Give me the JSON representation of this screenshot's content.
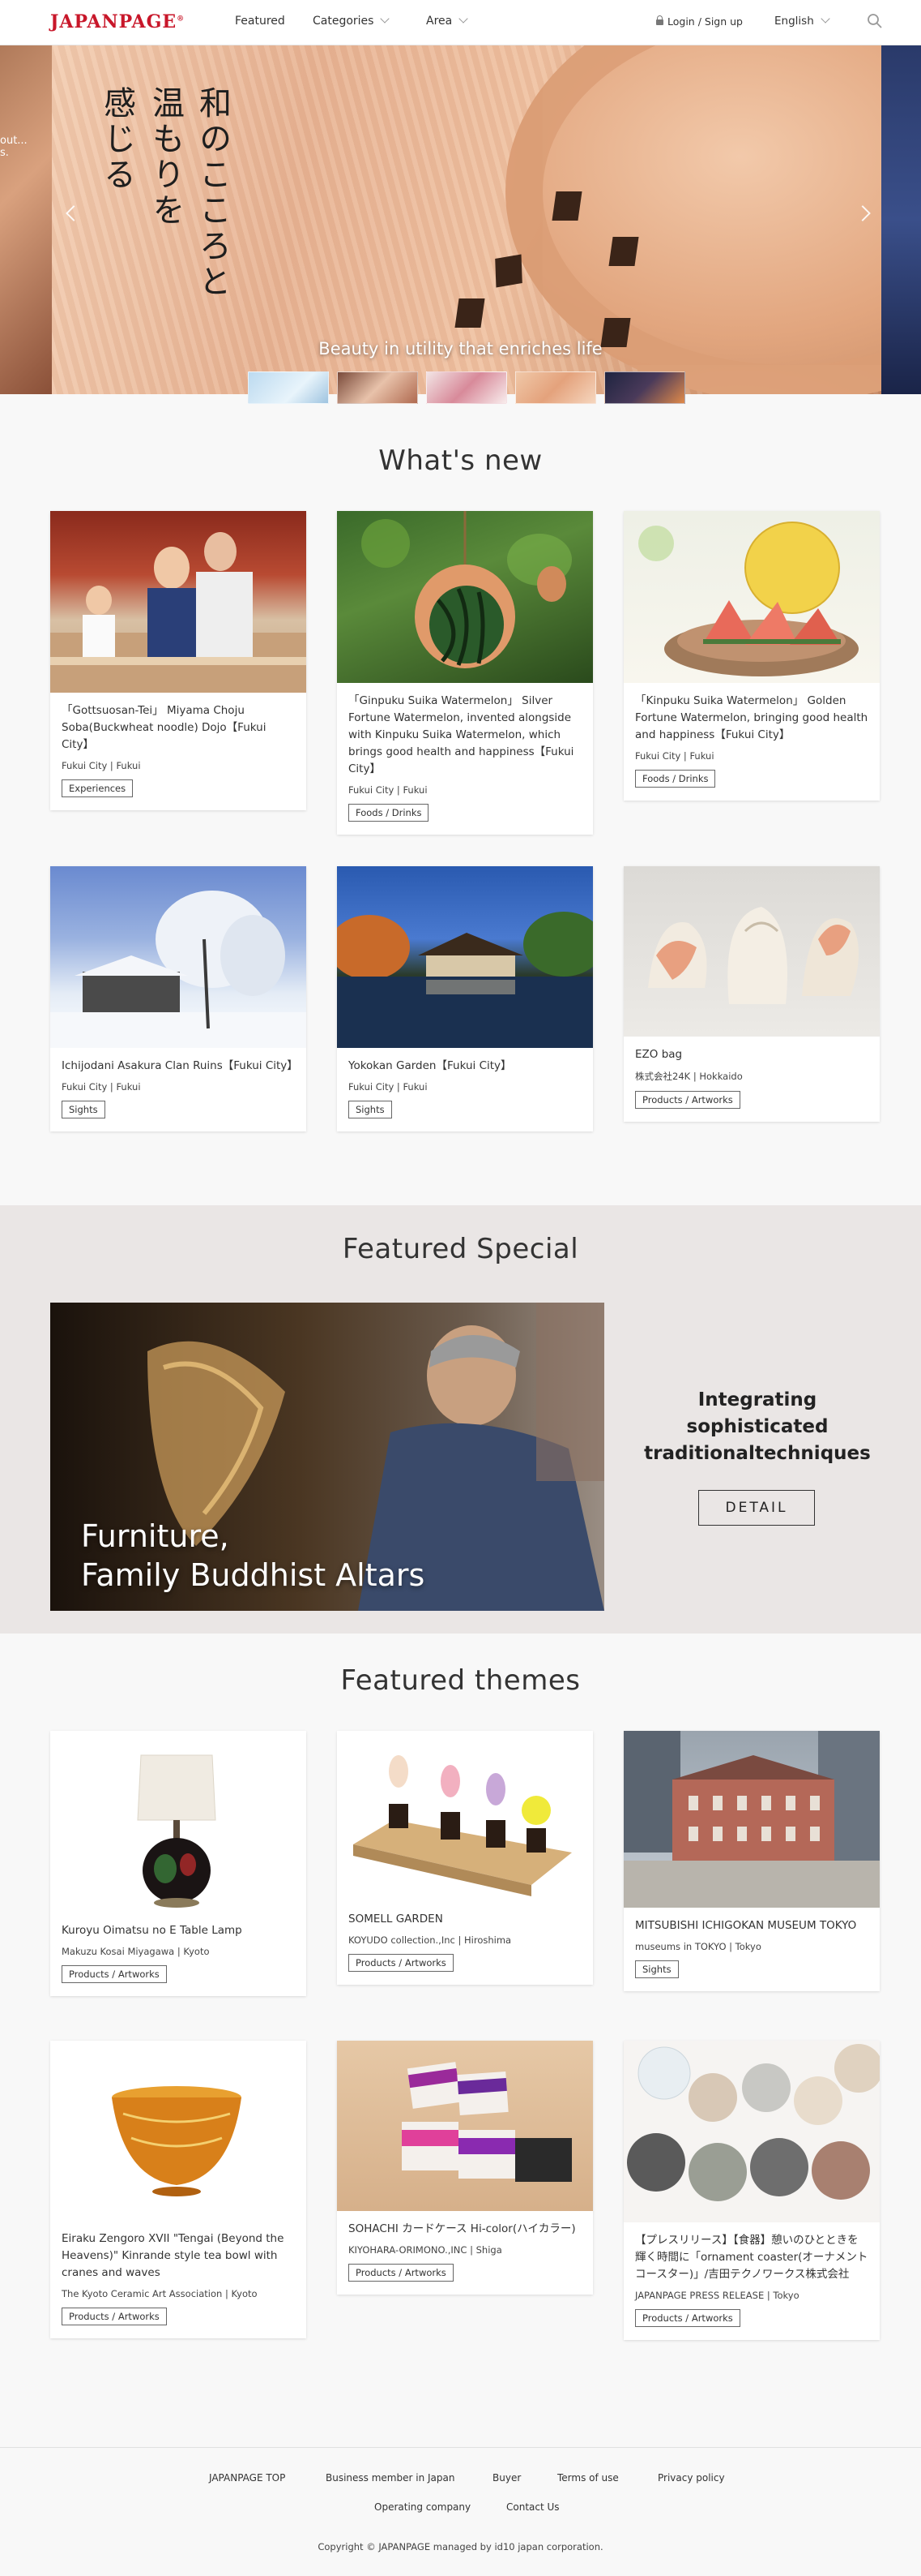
{
  "header": {
    "logo": "JAPANPAGE",
    "logo_mark": "®",
    "nav": {
      "featured": "Featured",
      "categories": "Categories",
      "area": "Area"
    },
    "login": "Login / Sign up",
    "language": "English"
  },
  "hero": {
    "left_fragment": "out... s.",
    "vertical_lines": [
      "和のこころと",
      "温もりを",
      "感じる"
    ],
    "caption": "Beauty in utility that enriches life"
  },
  "whats_new": {
    "title": "What's new",
    "cards": [
      {
        "title": "「Gottsuosan-Tei」 Miyama Choju Soba(Buckwheat noodle) Dojo【Fukui City】",
        "location": "Fukui City | Fukui",
        "tag": "Experiences"
      },
      {
        "title": "「Ginpuku Suika Watermelon」 Silver Fortune Watermelon, invented alongside with Kinpuku Suika Watermelon, which brings good health and happiness【Fukui City】",
        "location": "Fukui City | Fukui",
        "tag": "Foods / Drinks"
      },
      {
        "title": "「Kinpuku Suika Watermelon」 Golden Fortune Watermelon, bringing good health and happiness【Fukui City】",
        "location": "Fukui City | Fukui",
        "tag": "Foods / Drinks"
      },
      {
        "title": "Ichijodani Asakura Clan Ruins【Fukui City】",
        "location": "Fukui City | Fukui",
        "tag": "Sights"
      },
      {
        "title": "Yokokan Garden【Fukui City】",
        "location": "Fukui City | Fukui",
        "tag": "Sights"
      },
      {
        "title": "EZO bag",
        "location": "株式会社24K | Hokkaido",
        "tag": "Products / Artworks"
      }
    ]
  },
  "featured_special": {
    "title": "Featured Special",
    "overlay_line1": "Furniture,",
    "overlay_line2": "Family Buddhist Altars",
    "side_text": "Integrating sophisticated traditionaltechniques",
    "detail_label": "DETAIL"
  },
  "featured_themes": {
    "title": "Featured themes",
    "cards": [
      {
        "title": "Kuroyu Oimatsu no E Table Lamp",
        "location": "Makuzu Kosai Miyagawa | Kyoto",
        "tag": "Products / Artworks"
      },
      {
        "title": "SOMELL GARDEN",
        "location": "KOYUDO collection.,Inc | Hiroshima",
        "tag": "Products / Artworks"
      },
      {
        "title": "MITSUBISHI ICHIGOKAN MUSEUM TOKYO",
        "location": "museums in TOKYO | Tokyo",
        "tag": "Sights"
      },
      {
        "title": "Eiraku Zengoro XVII \"Tengai (Beyond the Heavens)\" Kinrande style tea bowl with cranes and waves",
        "location": "The Kyoto Ceramic Art Association | Kyoto",
        "tag": "Products / Artworks"
      },
      {
        "title": "SOHACHI カードケース Hi-color(ハイカラー)",
        "location": "KIYOHARA-ORIMONO.,INC | Shiga",
        "tag": "Products / Artworks"
      },
      {
        "title": "【プレスリリース】【食器】憩いのひとときを輝く時間に「ornament coaster(オーナメント コースター)」/吉田テクノワークス株式会社",
        "location": "JAPANPAGE PRESS RELEASE | Tokyo",
        "tag": "Products / Artworks"
      }
    ]
  },
  "footer": {
    "links": [
      "JAPANPAGE TOP",
      "Business member in Japan",
      "Buyer",
      "Terms of use",
      "Privacy policy",
      "Operating company",
      "Contact Us"
    ],
    "copyright": "Copyright © JAPANPAGE managed by id10 japan corporation."
  },
  "colors": {
    "brand": "#c8172a",
    "featured_bg": "#eae6e5",
    "page_bg": "#f8f8f8"
  }
}
